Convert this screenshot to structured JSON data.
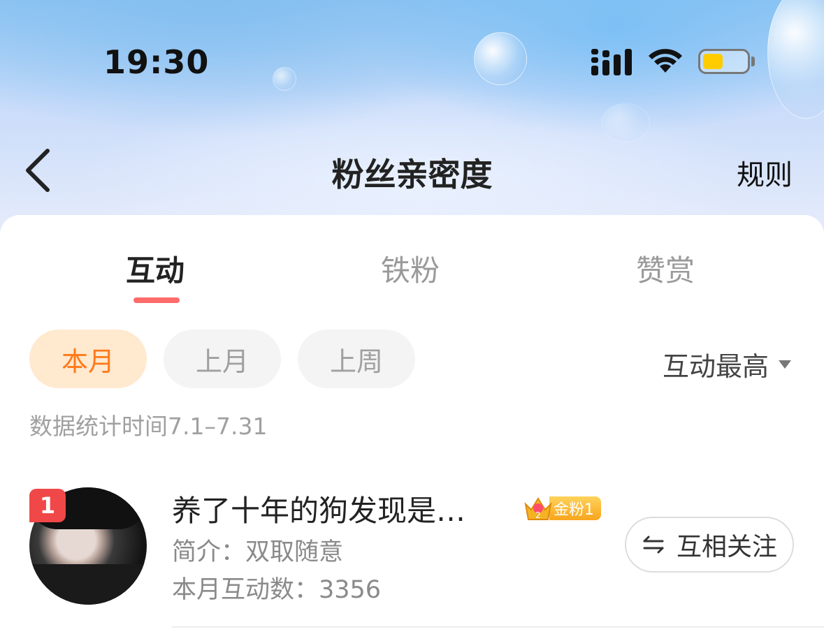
{
  "status_bar": {
    "time": "19:30",
    "icons": [
      "signal-icon",
      "wifi-icon",
      "battery-icon"
    ],
    "battery_color": "#ffcc00"
  },
  "nav": {
    "back_icon": "chevron-left-icon",
    "title": "粉丝亲密度",
    "rules_label": "规则"
  },
  "tabs": [
    {
      "label": "互动",
      "active": true
    },
    {
      "label": "铁粉",
      "active": false
    },
    {
      "label": "赞赏",
      "active": false
    }
  ],
  "filters": {
    "periods": [
      {
        "label": "本月",
        "active": true
      },
      {
        "label": "上月",
        "active": false
      },
      {
        "label": "上周",
        "active": false
      }
    ],
    "sort_label": "互动最高",
    "stat_range": "数据统计时间7.1–7.31"
  },
  "fans": [
    {
      "rank": "1",
      "name": "养了十年的狗发现是…",
      "badge_label": "金粉1",
      "bio": "简介：双取随意",
      "interaction_count": "本月互动数：3356",
      "follow_label": "互相关注"
    }
  ],
  "colors": {
    "accent": "#ff6b6b",
    "active_pill_bg": "#ffe9cf",
    "active_pill_text": "#ff7a1a",
    "rank_badge": "#f04848"
  }
}
